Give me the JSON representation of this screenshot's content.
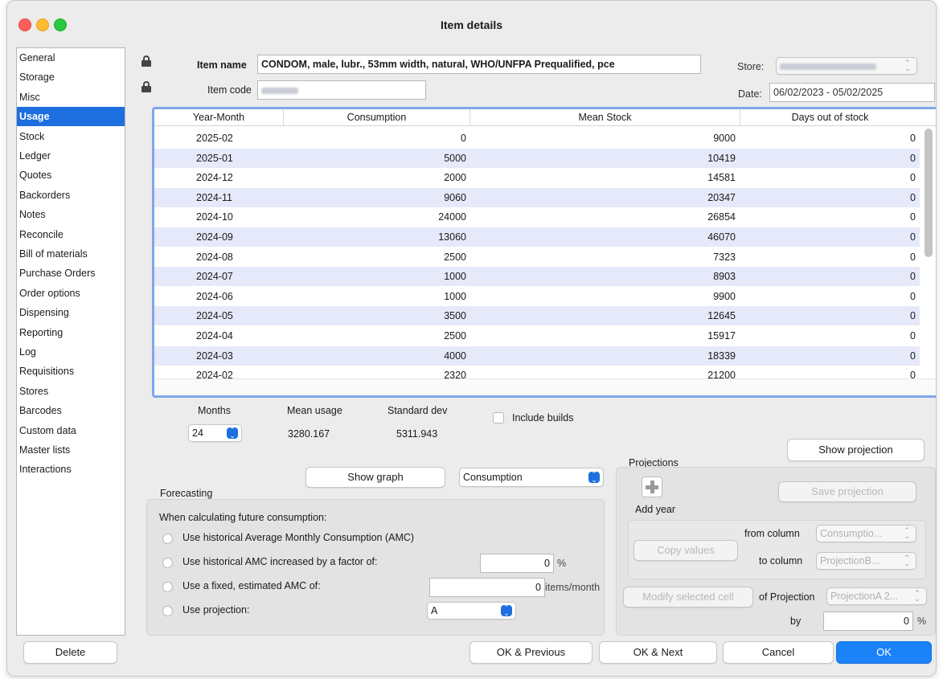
{
  "window": {
    "title": "Item details"
  },
  "sidebar": {
    "items": [
      {
        "label": "General"
      },
      {
        "label": "Storage"
      },
      {
        "label": "Misc"
      },
      {
        "label": "Usage"
      },
      {
        "label": "Stock"
      },
      {
        "label": "Ledger"
      },
      {
        "label": "Quotes"
      },
      {
        "label": "Backorders"
      },
      {
        "label": "Notes"
      },
      {
        "label": "Reconcile"
      },
      {
        "label": "Bill of materials"
      },
      {
        "label": "Purchase Orders"
      },
      {
        "label": "Order options"
      },
      {
        "label": "Dispensing"
      },
      {
        "label": "Reporting"
      },
      {
        "label": "Log"
      },
      {
        "label": "Requisitions"
      },
      {
        "label": "Stores"
      },
      {
        "label": "Barcodes"
      },
      {
        "label": "Custom data"
      },
      {
        "label": "Master lists"
      },
      {
        "label": "Interactions"
      }
    ],
    "selected": "Usage"
  },
  "header": {
    "item_name_label": "Item name",
    "item_name_value": "CONDOM, male, lubr., 53mm width, natural, WHO/UNFPA Prequalified, pce",
    "item_code_label": "Item code",
    "store_label": "Store:",
    "date_label": "Date:",
    "date_value": "06/02/2023 - 05/02/2025"
  },
  "table": {
    "columns": [
      "Year-Month",
      "Consumption",
      "Mean Stock",
      "Days out of stock"
    ],
    "rows": [
      [
        "2025-02",
        "0",
        "9000",
        "0"
      ],
      [
        "2025-01",
        "5000",
        "10419",
        "0"
      ],
      [
        "2024-12",
        "2000",
        "14581",
        "0"
      ],
      [
        "2024-11",
        "9060",
        "20347",
        "0"
      ],
      [
        "2024-10",
        "24000",
        "26854",
        "0"
      ],
      [
        "2024-09",
        "13060",
        "46070",
        "0"
      ],
      [
        "2024-08",
        "2500",
        "7323",
        "0"
      ],
      [
        "2024-07",
        "1000",
        "8903",
        "0"
      ],
      [
        "2024-06",
        "1000",
        "9900",
        "0"
      ],
      [
        "2024-05",
        "3500",
        "12645",
        "0"
      ],
      [
        "2024-04",
        "2500",
        "15917",
        "0"
      ],
      [
        "2024-03",
        "4000",
        "18339",
        "0"
      ],
      [
        "2024-02",
        "2320",
        "21200",
        "0"
      ]
    ]
  },
  "stats": {
    "months_label": "Months",
    "months_value": "24",
    "mean_usage_label": "Mean usage",
    "mean_usage_value": "3280.167",
    "std_dev_label": "Standard dev",
    "std_dev_value": "5311.943",
    "include_builds_label": "Include builds"
  },
  "graph": {
    "show_graph_label": "Show graph",
    "graph_type_value": "Consumption",
    "show_projection_label": "Show projection"
  },
  "forecasting": {
    "title": "Forecasting",
    "intro": "When calculating future consumption:",
    "option_amc": "Use historical Average Monthly Consumption (AMC)",
    "option_factor": "Use historical AMC increased by a factor of:",
    "factor_value": "0",
    "factor_unit": "%",
    "option_fixed": "Use a fixed, estimated AMC of:",
    "fixed_value": "0",
    "fixed_unit": "items/month",
    "option_projection": "Use projection:",
    "projection_value": "A"
  },
  "projections": {
    "title": "Projections",
    "add_year_label": "Add year",
    "save_projection_label": "Save projection",
    "copy_values_label": "Copy values",
    "from_column_label": "from column",
    "from_column_value": "Consumptio...",
    "to_column_label": "to column",
    "to_column_value": "ProjectionB...",
    "modify_cell_label": "Modify selected cell",
    "of_projection_label": "of Projection",
    "of_projection_value": "ProjectionA 2...",
    "by_label": "by",
    "by_value": "0",
    "by_unit": "%"
  },
  "footer": {
    "delete_label": "Delete",
    "ok_previous_label": "OK & Previous",
    "ok_next_label": "OK & Next",
    "cancel_label": "Cancel",
    "ok_label": "OK"
  },
  "colors": {
    "accent": "#1d6fe0",
    "row_alt": "#e6e9f9",
    "primary_button": "#1b82f8"
  }
}
